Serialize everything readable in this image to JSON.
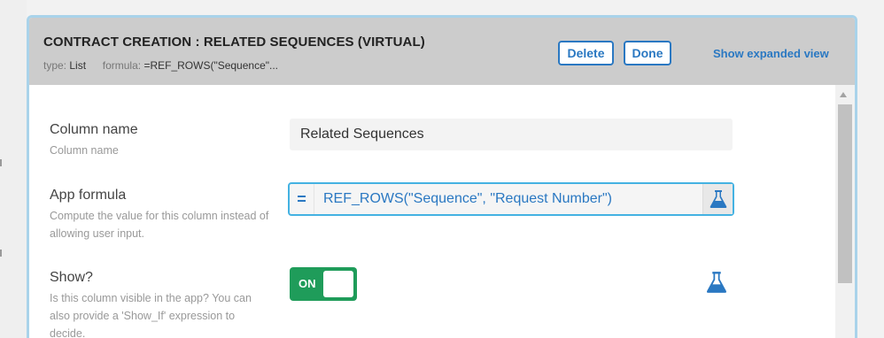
{
  "header": {
    "title": "CONTRACT CREATION : RELATED SEQUENCES (VIRTUAL)",
    "type_label": "type:",
    "type_value": "List",
    "formula_label": "formula:",
    "formula_value": "=REF_ROWS(\"Sequence\"...",
    "delete_label": "Delete",
    "done_label": "Done",
    "expanded_label": "Show expanded view"
  },
  "fields": {
    "column_name": {
      "label": "Column name",
      "hint": "Column name",
      "value": "Related Sequences"
    },
    "app_formula": {
      "label": "App formula",
      "hint": "Compute the value for this column instead of allowing user input.",
      "eq_symbol": "=",
      "value": "REF_ROWS(\"Sequence\", \"Request Number\")",
      "flask_icon": "flask-icon"
    },
    "show": {
      "label": "Show?",
      "hint": "Is this column visible in the app? You can also provide a 'Show_If' expression to decide.",
      "toggle_label": "ON",
      "toggle_state": "on",
      "flask_icon": "flask-icon"
    }
  },
  "colors": {
    "accent": "#2a78c2",
    "toggle_on": "#1f9c5a",
    "header_bg": "#cccccc",
    "panel_border": "#a9d3ea"
  }
}
